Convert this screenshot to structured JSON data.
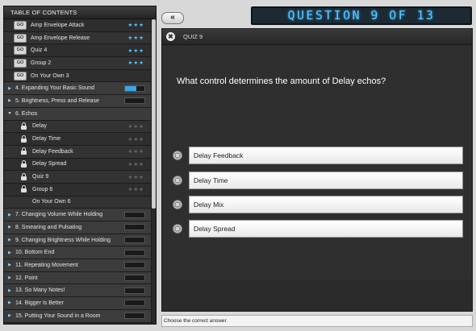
{
  "toc": {
    "title": "TABLE OF CONTENTS",
    "rows": [
      {
        "kind": "item",
        "marker": "go",
        "marker_label": "GO",
        "label": "Amp Envelope Attack",
        "stars": "★★★",
        "star_color": "blue"
      },
      {
        "kind": "item",
        "marker": "go",
        "marker_label": "GO",
        "label": "Amp Envelope Release",
        "stars": "★★★",
        "star_color": "blue"
      },
      {
        "kind": "item",
        "marker": "go",
        "marker_label": "GO",
        "label": "Quiz 4",
        "stars": "★★★",
        "star_color": "blue"
      },
      {
        "kind": "item",
        "marker": "go",
        "marker_label": "GO",
        "label": "Group 2",
        "stars": "★★★",
        "star_color": "blue"
      },
      {
        "kind": "item",
        "marker": "go",
        "marker_label": "GO",
        "label": "On Your Own 3",
        "stars": "",
        "star_color": "none"
      },
      {
        "kind": "section",
        "expanded": false,
        "label": "4. Expanding Your Basic Sound",
        "progress": 0.6
      },
      {
        "kind": "section",
        "expanded": false,
        "label": "5. Brightness, Press and Release",
        "progress": 0
      },
      {
        "kind": "section",
        "expanded": true,
        "label": "6. Echos",
        "progress": null
      },
      {
        "kind": "item",
        "marker": "lock",
        "label": "Delay",
        "stars": "★★★",
        "star_color": "grey"
      },
      {
        "kind": "item",
        "marker": "lock",
        "label": "Delay Time",
        "stars": "★★★",
        "star_color": "grey"
      },
      {
        "kind": "item",
        "marker": "lock",
        "label": "Delay Feedback",
        "stars": "★★★",
        "star_color": "grey"
      },
      {
        "kind": "item",
        "marker": "lock",
        "label": "Delay Spread",
        "stars": "★★★",
        "star_color": "grey"
      },
      {
        "kind": "item",
        "marker": "lock",
        "label": "Quiz 9",
        "stars": "★★★",
        "star_color": "grey"
      },
      {
        "kind": "item",
        "marker": "lock",
        "label": "Group 6",
        "stars": "★★★",
        "star_color": "grey"
      },
      {
        "kind": "item",
        "marker": "none",
        "label": "On Your Own 6",
        "stars": "",
        "star_color": "none"
      },
      {
        "kind": "section",
        "expanded": false,
        "label": "7. Changing Volume While Holding",
        "progress": 0
      },
      {
        "kind": "section",
        "expanded": false,
        "label": "8. Smearing and Pulsating",
        "progress": 0
      },
      {
        "kind": "section",
        "expanded": false,
        "label": "9. Changing Brightness While Holding",
        "progress": 0
      },
      {
        "kind": "section",
        "expanded": false,
        "label": "10. Bottom End",
        "progress": 0
      },
      {
        "kind": "section",
        "expanded": false,
        "label": "11. Repeating Movement",
        "progress": 0
      },
      {
        "kind": "section",
        "expanded": false,
        "label": "12. Point",
        "progress": 0
      },
      {
        "kind": "section",
        "expanded": false,
        "label": "13. So Many Notes!",
        "progress": 0
      },
      {
        "kind": "section",
        "expanded": false,
        "label": "14. Bigger Is Better",
        "progress": 0
      },
      {
        "kind": "section",
        "expanded": false,
        "label": "15. Putting Your Sound in a Room",
        "progress": 0
      }
    ]
  },
  "header": {
    "collapse_label": "«",
    "counter": "QUESTION 9 OF 13"
  },
  "quiz": {
    "close_glyph": "✖",
    "title": "QUIZ 9",
    "question": "What control determines the amount of Delay echos?",
    "answers": [
      "Delay Feedback",
      "Delay Time",
      "Delay Mix",
      "Delay Spread"
    ]
  },
  "status": {
    "text": "Choose the correct answer."
  },
  "colors": {
    "accent": "#5ec8ff",
    "progress_fill": "#3aa3e6"
  }
}
